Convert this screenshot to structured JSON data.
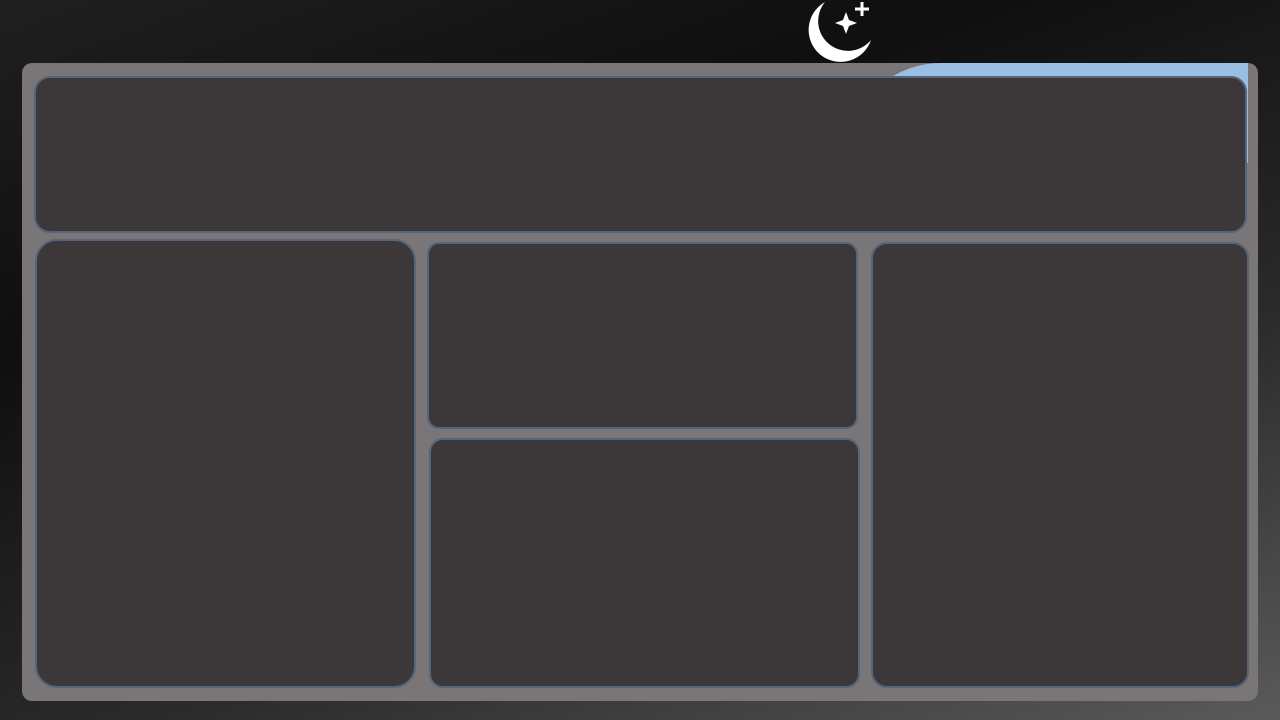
{
  "theme_toggle": {
    "icon": "moon-stars-icon",
    "mode": "dark"
  },
  "colors": {
    "page_background": "#141414",
    "frame_background": "#7a7576",
    "panel_background": "#3c3839",
    "panel_border": "#55657a",
    "accent": "#9bbfe3",
    "icon": "#ffffff"
  },
  "layout": {
    "panels": [
      {
        "id": "header-panel",
        "content": ""
      },
      {
        "id": "left-panel",
        "content": ""
      },
      {
        "id": "center-top-panel",
        "content": ""
      },
      {
        "id": "center-bottom-panel",
        "content": ""
      },
      {
        "id": "right-panel",
        "content": ""
      }
    ]
  }
}
